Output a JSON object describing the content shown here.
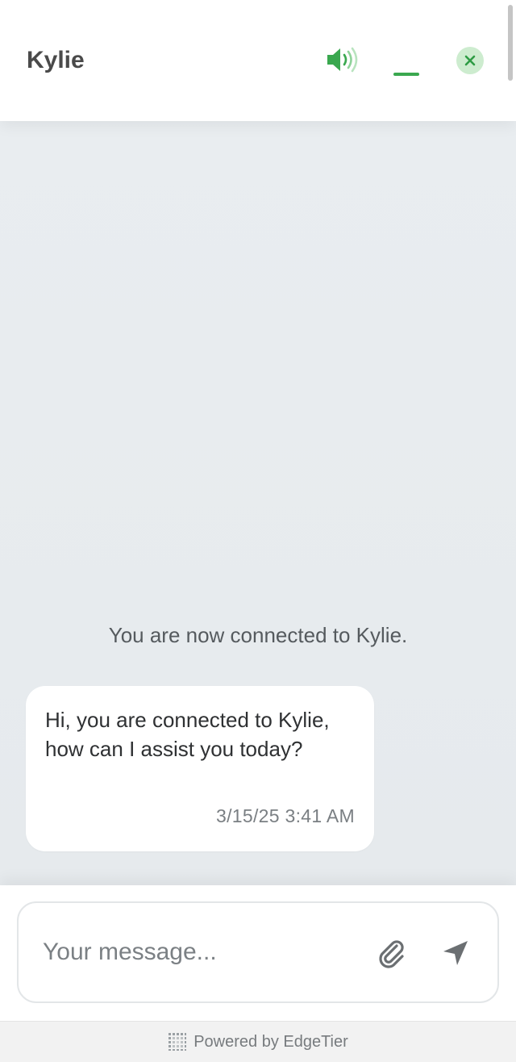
{
  "header": {
    "agent_name": "Kylie",
    "sound_icon": "speaker-on-icon",
    "minimize_icon": "minimize-icon",
    "close_icon": "close-icon"
  },
  "chat": {
    "system_message": "You are now connected to Kylie.",
    "messages": [
      {
        "text": "Hi, you are connected to Kylie, how can I assist you today?",
        "timestamp": "3/15/25 3:41 AM"
      }
    ]
  },
  "composer": {
    "placeholder": "Your message...",
    "value": "",
    "attach_icon": "paperclip-icon",
    "send_icon": "send-arrow-icon"
  },
  "footer": {
    "text": "Powered by EdgeTier",
    "icon": "edgetier-logo-icon"
  },
  "colors": {
    "accent": "#3aa84f",
    "accent_light": "#cdeccf",
    "chat_background": "#e9edf0",
    "bubble_background": "#ffffff"
  }
}
